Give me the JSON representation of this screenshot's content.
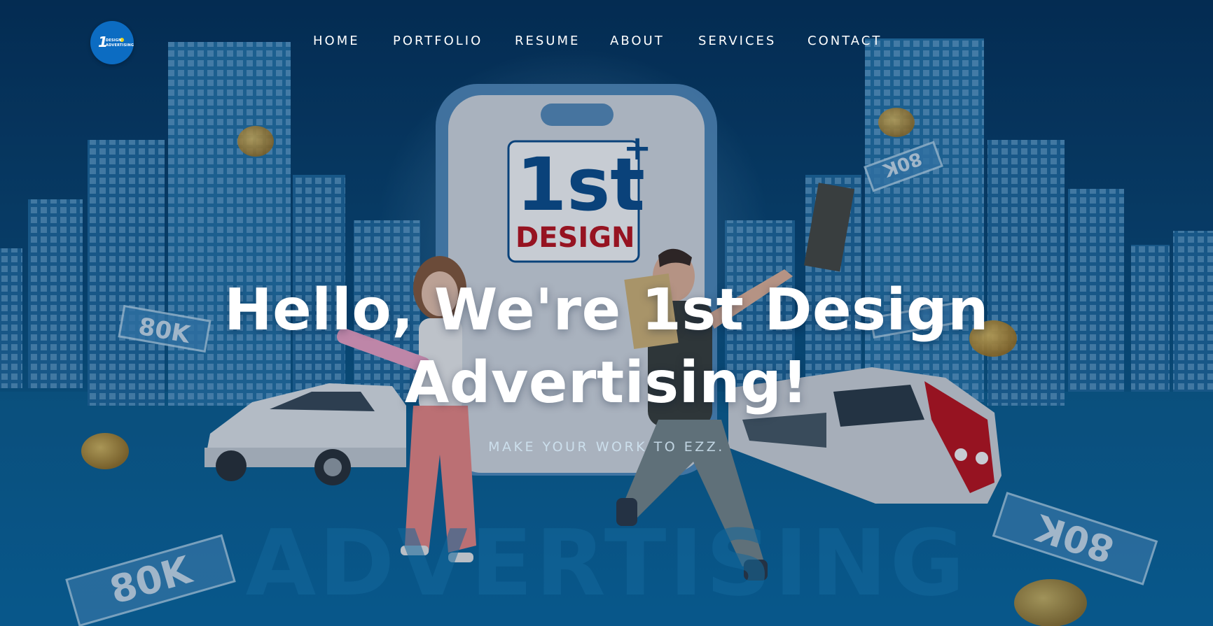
{
  "brand": {
    "logo_number": "1",
    "logo_line1": "DESIGN",
    "logo_line2": "ADVERTISING",
    "phone_logo_main": "1st",
    "phone_logo_sub": "DESIGN",
    "phone_logo_plus": "+"
  },
  "nav": {
    "items": [
      {
        "label": "HOME"
      },
      {
        "label": "PORTFOLIO"
      },
      {
        "label": "RESUME"
      },
      {
        "label": "ABOUT"
      },
      {
        "label": "SERVICES"
      },
      {
        "label": "CONTACT"
      }
    ]
  },
  "hero": {
    "headline_line1": "Hello, We're 1st Design",
    "headline_line2": "Advertising!",
    "subtitle": "MAKE YOUR WORK TO EZZ.",
    "ticket_label": "80K",
    "street_text": "ADVERTISING"
  },
  "colors": {
    "background_top": "#06325a",
    "background_bottom": "#0a6a9c",
    "logo_circle": "#0c6cc2",
    "brand_blue": "#0e4f8e",
    "brand_red": "#c0121c",
    "text_primary": "#ffffff"
  }
}
